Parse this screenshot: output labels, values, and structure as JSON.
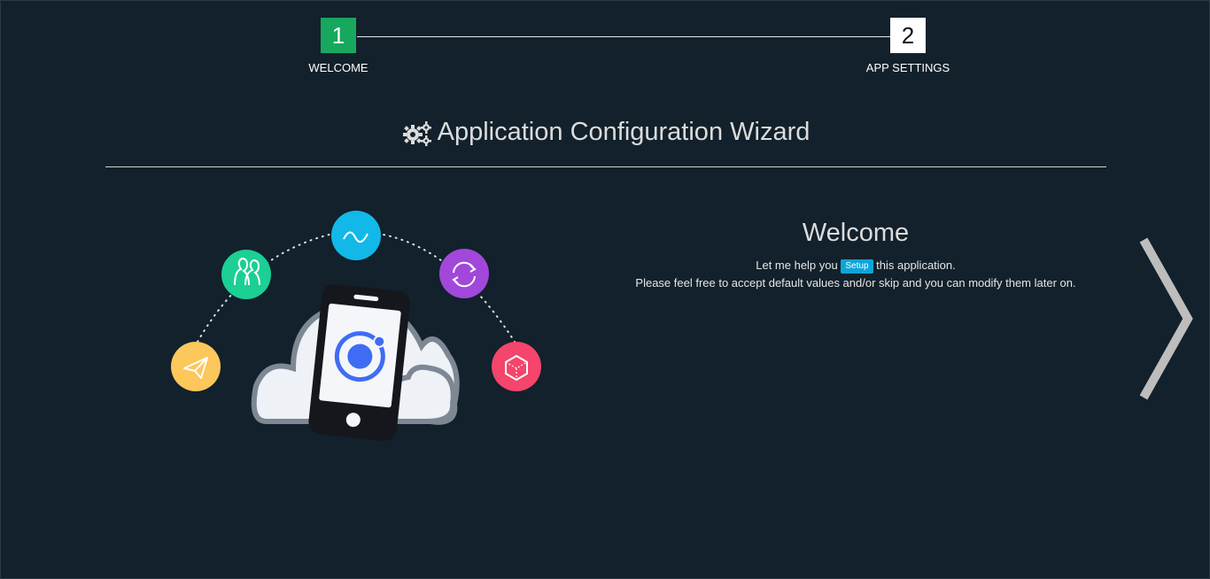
{
  "stepper": {
    "steps": [
      {
        "number": "1",
        "label": "WELCOME",
        "active": true
      },
      {
        "number": "2",
        "label": "APP SETTINGS",
        "active": false
      }
    ]
  },
  "header": {
    "title": "Application Configuration Wizard",
    "title_icon": "gears-icon"
  },
  "welcome": {
    "heading": "Welcome",
    "line1_before": "Let me help you",
    "badge": "Setup",
    "line1_after": "this application.",
    "line2": "Please feel free to accept default values and/or skip and you can modify them later on."
  },
  "illustration": {
    "icons": [
      "send-icon",
      "people-icon",
      "wave-icon",
      "sync-icon",
      "cube-icon",
      "ionic-logo-icon",
      "phone-icon",
      "cloud-icon"
    ]
  },
  "navigation": {
    "next_icon": "chevron-right-icon"
  },
  "colors": {
    "background": "#12212b",
    "step_active": "#17a85e",
    "badge": "#0ea5d8",
    "yellow_circle": "#fcc75b",
    "green_circle": "#1ccf94",
    "cyan_circle": "#12b9e8",
    "purple_circle": "#a148db",
    "pink_circle": "#f4456c",
    "ionic_blue": "#3f6cf4"
  }
}
